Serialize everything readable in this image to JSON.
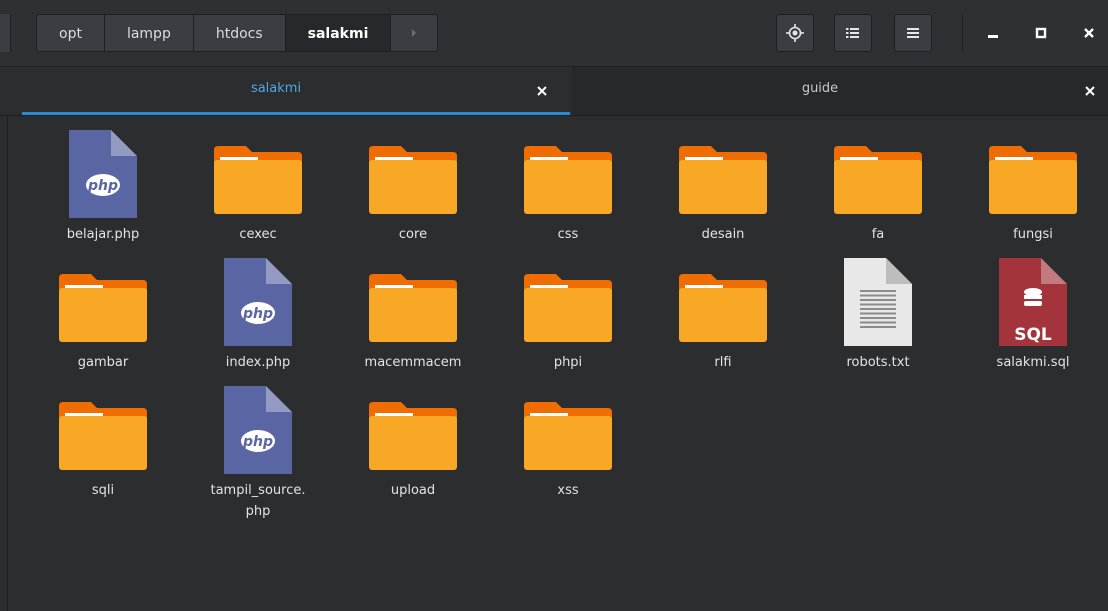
{
  "path_bar": {
    "crumbs": [
      "opt",
      "lampp",
      "htdocs",
      "salakmi"
    ],
    "active_index": 3
  },
  "toolbar": {
    "locate_icon": "crosshair-icon",
    "list_view_icon": "list-view-icon",
    "menu_icon": "hamburger-menu-icon"
  },
  "window_controls": {
    "minimize_icon": "minimize-icon",
    "maximize_icon": "maximize-icon",
    "close_icon": "close-icon"
  },
  "tabs": [
    {
      "label": "salakmi",
      "active": true
    },
    {
      "label": "guide",
      "active": false
    }
  ],
  "colors": {
    "accent": "#2a8ad2",
    "folder": "#f9a825",
    "folder_tab": "#ef6c00",
    "php": "#5a66a3",
    "sql": "#a3343b"
  },
  "files": [
    {
      "name": "belajar.php",
      "type": "php"
    },
    {
      "name": "cexec",
      "type": "folder"
    },
    {
      "name": "core",
      "type": "folder"
    },
    {
      "name": "css",
      "type": "folder"
    },
    {
      "name": "desain",
      "type": "folder"
    },
    {
      "name": "fa",
      "type": "folder"
    },
    {
      "name": "fungsi",
      "type": "folder"
    },
    {
      "name": "gambar",
      "type": "folder"
    },
    {
      "name": "index.php",
      "type": "php"
    },
    {
      "name": "macemmacem",
      "type": "folder"
    },
    {
      "name": "phpi",
      "type": "folder"
    },
    {
      "name": "rlfi",
      "type": "folder"
    },
    {
      "name": "robots.txt",
      "type": "text"
    },
    {
      "name": "salakmi.sql",
      "type": "sql"
    },
    {
      "name": "sqli",
      "type": "folder"
    },
    {
      "name": "tampil_source.",
      "name_line2": "php",
      "type": "php"
    },
    {
      "name": "upload",
      "type": "folder"
    },
    {
      "name": "xss",
      "type": "folder"
    }
  ],
  "icon_text": {
    "php": "php",
    "sql": "SQL"
  }
}
